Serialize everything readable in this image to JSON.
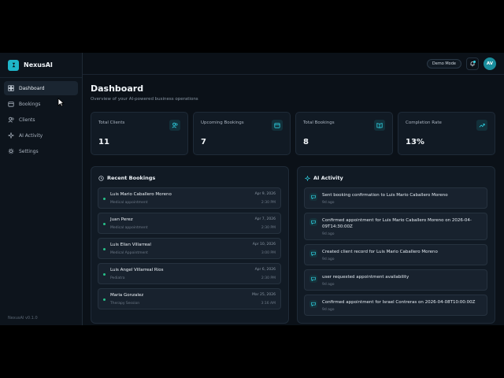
{
  "brand": {
    "name": "NexusAI"
  },
  "sidebar": {
    "items": [
      {
        "label": "Dashboard",
        "icon": "dashboard-icon",
        "active": true
      },
      {
        "label": "Bookings",
        "icon": "calendar-icon",
        "active": false
      },
      {
        "label": "Clients",
        "icon": "users-icon",
        "active": false
      },
      {
        "label": "AI Activity",
        "icon": "sparkle-icon",
        "active": false
      },
      {
        "label": "Settings",
        "icon": "gear-icon",
        "active": false
      }
    ],
    "version": "NexusAI v0.1.0"
  },
  "topbar": {
    "demo_label": "Demo Mode",
    "avatar_initials": "AV"
  },
  "header": {
    "title": "Dashboard",
    "subtitle": "Overview of your AI-powered business operations"
  },
  "stats": [
    {
      "label": "Total Clients",
      "value": "11",
      "icon": "users-icon"
    },
    {
      "label": "Upcoming Bookings",
      "value": "7",
      "icon": "calendar-icon"
    },
    {
      "label": "Total Bookings",
      "value": "8",
      "icon": "book-icon"
    },
    {
      "label": "Completion Rate",
      "value": "13%",
      "icon": "trend-up-icon"
    }
  ],
  "recent_bookings": {
    "title": "Recent Bookings",
    "items": [
      {
        "name": "Luis Mario Caballero Moreno",
        "type": "Medical appointment",
        "date": "Apr 9, 2026",
        "time": "2:30 PM"
      },
      {
        "name": "Juan Perez",
        "type": "Medical appointment",
        "date": "Apr 7, 2026",
        "time": "2:30 PM"
      },
      {
        "name": "Luis Elian Villarreal",
        "type": "Medical Appointment",
        "date": "Apr 10, 2026",
        "time": "3:00 PM"
      },
      {
        "name": "Luis Angel Villarreal Rios",
        "type": "Pediatra",
        "date": "Apr 6, 2026",
        "time": "2:30 PM"
      },
      {
        "name": "Maria Gonzalez",
        "type": "Therapy Session",
        "date": "Mar 25, 2026",
        "time": "3:16 AM"
      }
    ]
  },
  "ai_activity": {
    "title": "AI Activity",
    "items": [
      {
        "text": "Sent booking confirmation to Luis Mario Caballero Moreno",
        "time": "9d ago"
      },
      {
        "text": "Confirmed appointment for Luis Mario Caballero Moreno on 2026-04-09T14:30:00Z",
        "time": "9d ago"
      },
      {
        "text": "Created client record for Luis Mario Caballero Moreno",
        "time": "9d ago"
      },
      {
        "text": "user requested appointment availability",
        "time": "9d ago"
      },
      {
        "text": "Confirmed appointment for Israel Contreras on 2026-04-08T10:00:00Z",
        "time": "9d ago"
      }
    ]
  },
  "colors": {
    "accent": "#1fb5c9",
    "status_dot": "#27c18a",
    "background": "#0b1118",
    "card": "#111a24"
  }
}
